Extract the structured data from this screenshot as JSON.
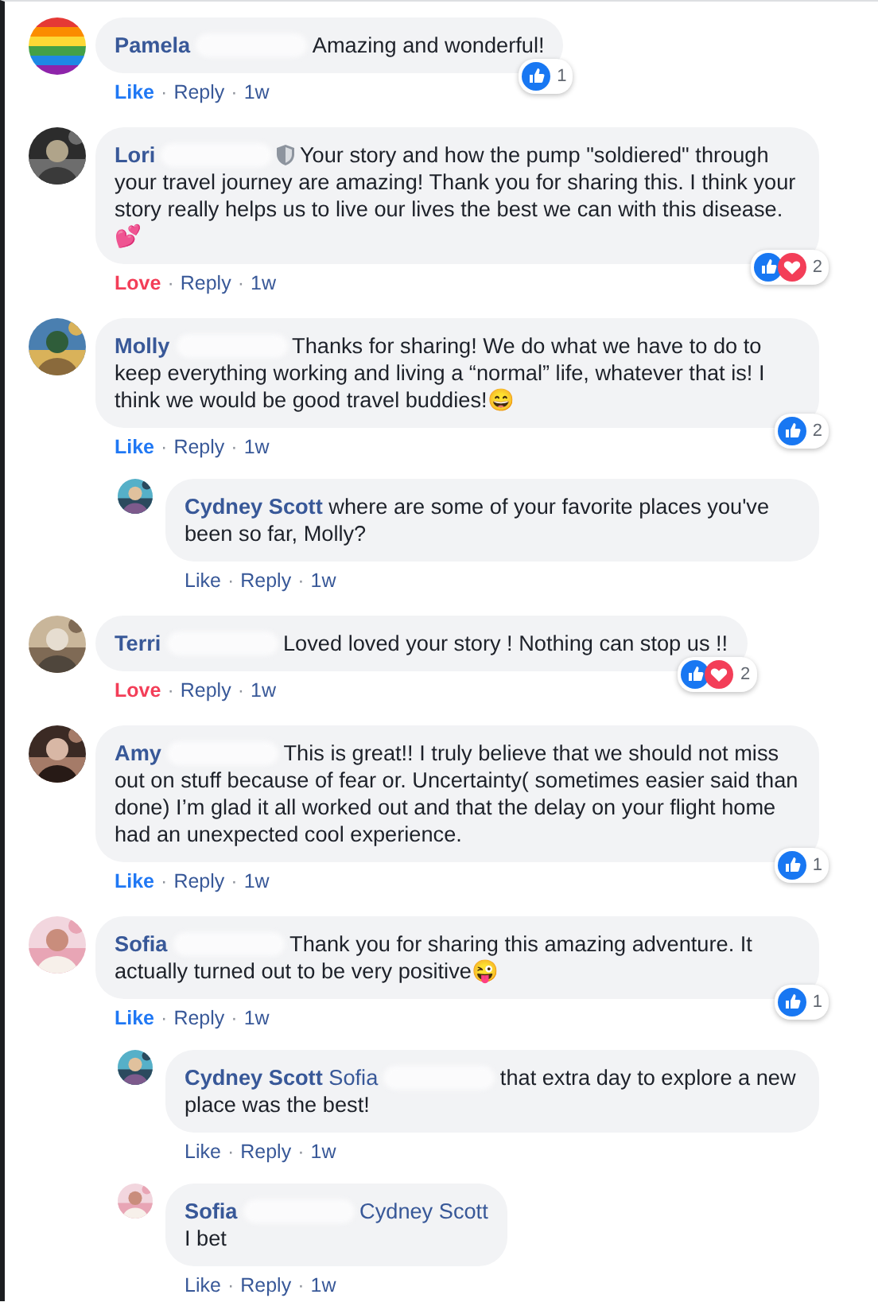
{
  "comments": [
    {
      "author": "Pamela",
      "blurred": true,
      "text": "Amazing and wonderful!",
      "reactions": {
        "icons": [
          {
            "kind": "like"
          }
        ],
        "count": "1"
      },
      "liked": true,
      "loved": false,
      "actions": [
        "Like",
        "·",
        "Reply",
        "·",
        "1w"
      ]
    },
    {
      "author": "Lori",
      "blurred": true,
      "shield": true,
      "text": "Your story and how the pump \"soldiered\" through your travel journey are amazing! Thank you for sharing this. I think your story really helps us to live our lives the best we can with this disease.💕",
      "reactions": {
        "icons": [
          {
            "kind": "like"
          },
          {
            "kind": "love"
          }
        ],
        "count": "2"
      },
      "loved": true,
      "actions": [
        "Love",
        "·",
        "Reply",
        "·",
        "1w"
      ]
    },
    {
      "author": "Molly",
      "blurred": true,
      "text": "Thanks for sharing! We do what we have to do to keep everything working and living a “normal” life, whatever that is! I think we would be good travel buddies!😄",
      "reactions": {
        "icons": [
          {
            "kind": "like"
          }
        ],
        "count": "2"
      },
      "liked": true,
      "loved": false,
      "actions": [
        "Like",
        "·",
        "Reply",
        "·",
        "1w"
      ],
      "replies": [
        {
          "author": "Cydney Scott",
          "blurred": false,
          "text": "where are some of your favorite places you've been so far, Molly?",
          "liked": false,
          "loved": false,
          "actions": [
            "Like",
            "·",
            "Reply",
            "·",
            "1w"
          ]
        }
      ]
    },
    {
      "author": "Terri",
      "blurred": true,
      "text": "Loved loved your story ! Nothing can stop us !!",
      "reactions": {
        "icons": [
          {
            "kind": "like"
          },
          {
            "kind": "love"
          }
        ],
        "count": "2"
      },
      "loved": true,
      "actions": [
        "Love",
        "·",
        "Reply",
        "·",
        "1w"
      ]
    },
    {
      "author": "Amy",
      "blurred": true,
      "text": "This is great!! I truly believe that we should not miss out on stuff because of fear or. Uncertainty( sometimes easier said than done) I’m glad it all worked out and that the delay on your flight home had an unexpected cool experience.",
      "reactions": {
        "icons": [
          {
            "kind": "like"
          }
        ],
        "count": "1"
      },
      "liked": true,
      "loved": false,
      "actions": [
        "Like",
        "·",
        "Reply",
        "·",
        "1w"
      ]
    },
    {
      "author": "Sofia",
      "blurred": true,
      "text": "Thank you for sharing this amazing adventure. It actually turned out to be very positive😜",
      "reactions": {
        "icons": [
          {
            "kind": "like"
          }
        ],
        "count": "1"
      },
      "liked": true,
      "loved": false,
      "actions": [
        "Like",
        "·",
        "Reply",
        "·",
        "1w"
      ],
      "replies": [
        {
          "author": "Cydney Scott",
          "blurred": false,
          "mention": {
            "name": "Sofia",
            "blurred": true
          },
          "text": "that extra day to explore a new place was the best!",
          "liked": false,
          "loved": false,
          "actions": [
            "Like",
            "·",
            "Reply",
            "·",
            "1w"
          ]
        },
        {
          "author": "Sofia",
          "blurred": true,
          "mention": {
            "name": "Cydney Scott",
            "blurred": false
          },
          "text": "I bet",
          "text_on_new_line": true,
          "liked": false,
          "loved": false,
          "actions": [
            "Like",
            "·",
            "Reply",
            "·",
            "1w"
          ]
        }
      ]
    }
  ]
}
